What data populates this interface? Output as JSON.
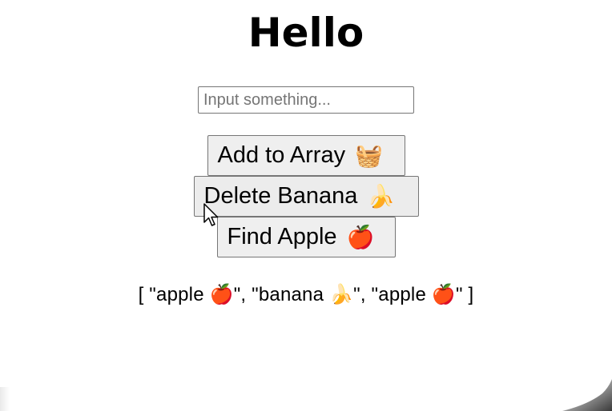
{
  "header": {
    "title": "Hello"
  },
  "input": {
    "placeholder": "Input something...",
    "value": ""
  },
  "buttons": {
    "add": {
      "label": "Add to Array",
      "emoji": "🧺",
      "icon": "basket-icon"
    },
    "delete": {
      "label": "Delete Banana",
      "emoji": "🍌",
      "icon": "banana-icon"
    },
    "find": {
      "label": "Find Apple",
      "emoji": "🍎",
      "icon": "apple-icon"
    }
  },
  "output": {
    "array_text": "[ \"apple 🍎\", \"banana 🍌\", \"apple 🍎\" ]"
  },
  "colors": {
    "button_bg": "#efefef",
    "button_border": "#767676",
    "text": "#000000"
  }
}
